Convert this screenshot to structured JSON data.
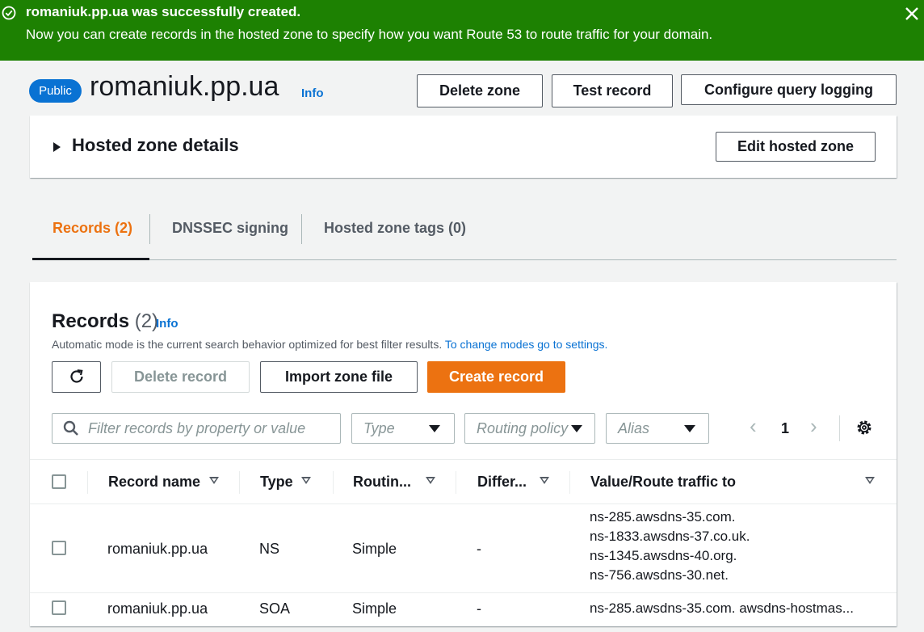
{
  "flash": {
    "title": "romaniuk.pp.ua was successfully created.",
    "message": "Now you can create records in the hosted zone to specify how you want Route 53 to route traffic for your domain."
  },
  "zone": {
    "badge": "Public",
    "name": "romaniuk.pp.ua",
    "info": "Info",
    "buttons": {
      "delete_zone": "Delete zone",
      "test_record": "Test record",
      "configure_logging": "Configure query logging"
    }
  },
  "details": {
    "title": "Hosted zone details",
    "edit": "Edit hosted zone"
  },
  "tabs": [
    {
      "label": "Records (2)"
    },
    {
      "label": "DNSSEC signing"
    },
    {
      "label": "Hosted zone tags (0)"
    }
  ],
  "records": {
    "title": "Records",
    "count": "(2)",
    "info": "Info",
    "description": "Automatic mode is the current search behavior optimized for best filter results.",
    "settings_link": "To change modes go to settings.",
    "buttons": {
      "delete_record": "Delete record",
      "import_zone_file": "Import zone file",
      "create_record": "Create record"
    },
    "filter_placeholder": "Filter records by property or value",
    "filters": {
      "type": "Type",
      "routing": "Routing policy",
      "alias": "Alias"
    },
    "page": "1",
    "columns": [
      "Record name",
      "Type",
      "Routin...",
      "Differ...",
      "Value/Route traffic to"
    ],
    "rows": [
      {
        "name": "romaniuk.pp.ua",
        "type": "NS",
        "routing": "Simple",
        "differ": "-",
        "values": [
          "ns-285.awsdns-35.com.",
          "ns-1833.awsdns-37.co.uk.",
          "ns-1345.awsdns-40.org.",
          "ns-756.awsdns-30.net."
        ]
      },
      {
        "name": "romaniuk.pp.ua",
        "type": "SOA",
        "routing": "Simple",
        "differ": "-",
        "values": [
          "ns-285.awsdns-35.com. awsdns-hostmas..."
        ]
      }
    ]
  },
  "icons": {
    "success": "check-circle-icon",
    "close": "close-icon",
    "refresh": "refresh-icon",
    "search": "search-icon",
    "settings": "gear-icon"
  },
  "colors": {
    "success": "#1d8102",
    "primary": "#ec7211",
    "link": "#0972d3"
  }
}
